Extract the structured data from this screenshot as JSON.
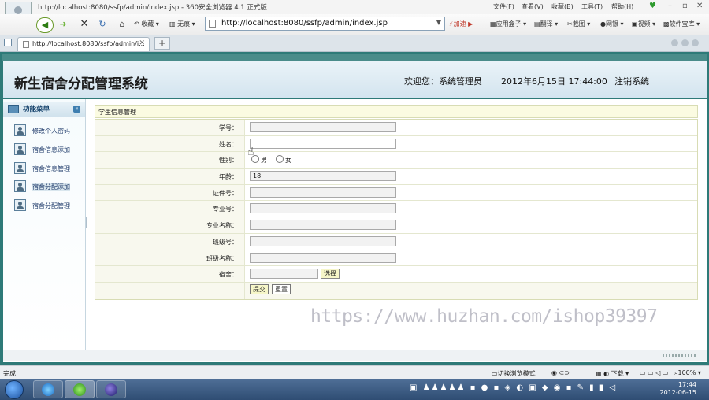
{
  "browser": {
    "window_title": "http://localhost:8080/ssfp/admin/index.jsp - 360安全浏览器 4.1 正式版",
    "menu": [
      "文件(F)",
      "查看(V)",
      "收藏(B)",
      "工具(T)",
      "帮助(H)"
    ],
    "nav": {
      "favorites": "收藏",
      "trace": "无痕",
      "url": "http://localhost:8080/ssfp/admin/index.jsp",
      "speedup": "加速",
      "tools": [
        "应用盒子",
        "翻译",
        "截图",
        "网银",
        "视频",
        "软件宝库"
      ]
    },
    "tab_label": "http://localhost:8080/ssfp/admin/i...",
    "status_left": "完成",
    "status_right": {
      "mode": "切换浏览模式",
      "download": "下载",
      "zoom": "100%"
    }
  },
  "app": {
    "title": "新生宿舍分配管理系统",
    "welcome": "欢迎您：系统管理员",
    "datetime": "2012年6月15日  17:44:00",
    "logout": "注销系统"
  },
  "sidebar": {
    "title": "功能菜单",
    "items": [
      {
        "label": "修改个人密码"
      },
      {
        "label": "宿舍信息添加"
      },
      {
        "label": "宿舍信息管理"
      },
      {
        "label": "宿舍分配添加"
      },
      {
        "label": "宿舍分配管理"
      }
    ]
  },
  "form": {
    "section_title": "学生信息管理",
    "fields": [
      {
        "label": "学号：",
        "value": ""
      },
      {
        "label": "姓名：",
        "value": ""
      },
      {
        "label": "性别：",
        "options": [
          "男",
          "女"
        ]
      },
      {
        "label": "年龄：",
        "value": "18"
      },
      {
        "label": "证件号：",
        "value": ""
      },
      {
        "label": "专业号：",
        "value": ""
      },
      {
        "label": "专业名称：",
        "value": ""
      },
      {
        "label": "班级号：",
        "value": ""
      },
      {
        "label": "班级名称：",
        "value": ""
      },
      {
        "label": "宿舍：",
        "value": ""
      }
    ],
    "choose_label": "选择",
    "submit_label": "提交",
    "reset_label": "重置"
  },
  "watermark": "https://www.huzhan.com/ishop39397",
  "taskbar": {
    "time": "17:44",
    "date": "2012-06-15"
  },
  "colors": {
    "frame": "#2e7a78",
    "header": "#d3e4ef",
    "form_label_bg": "#f8f8ee",
    "section_bg": "#fbfbe1"
  }
}
